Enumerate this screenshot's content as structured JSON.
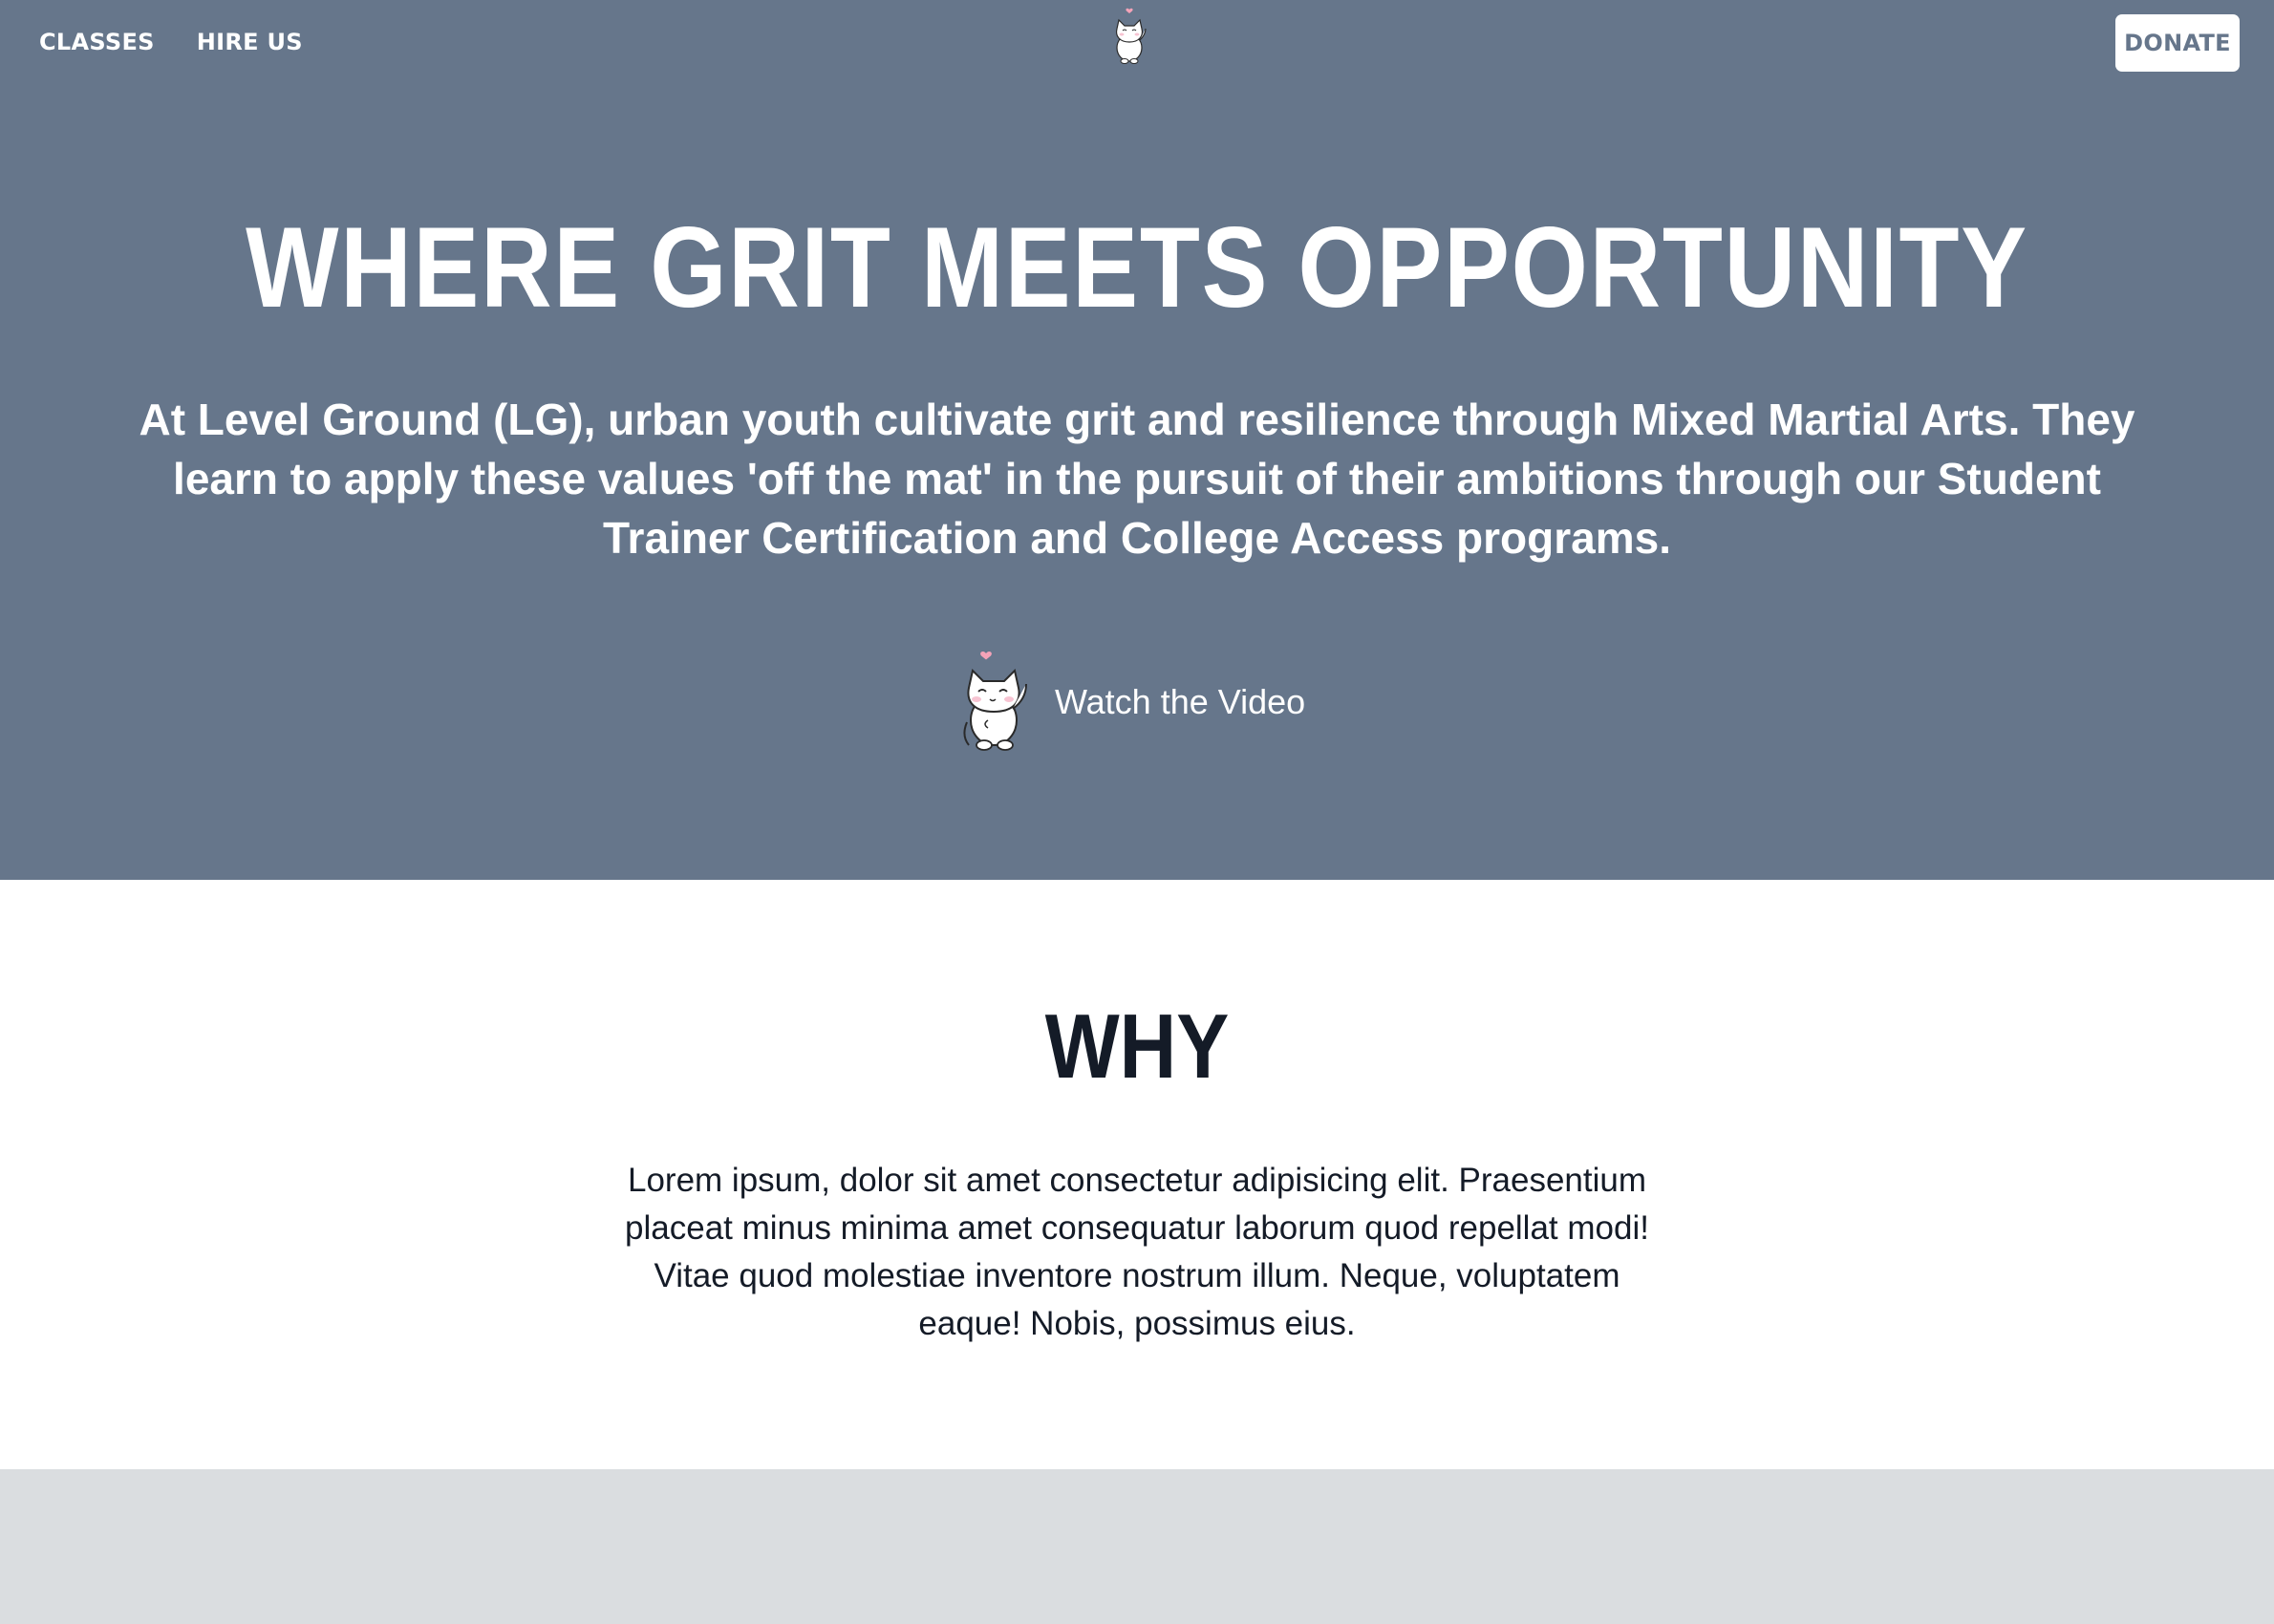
{
  "nav": {
    "links": [
      {
        "label": "CLASSES"
      },
      {
        "label": "HIRE US"
      }
    ],
    "donate_label": "DONATE",
    "logo_icon": "cat-mascot-icon"
  },
  "hero": {
    "title": "WHERE GRIT MEETS OPPORTUNITY",
    "subtitle": "At Level Ground (LG), urban youth cultivate grit and resilience through Mixed Martial Arts. They learn to apply these values 'off the mat' in the pursuit of their ambitions through our Student Trainer Certification and College Access programs.",
    "video_label": "Watch the Video",
    "video_icon": "cat-mascot-icon"
  },
  "why": {
    "title": "WHY",
    "body": "Lorem ipsum, dolor sit amet consectetur adipisicing elit. Praesentium placeat minus minima amet consequatur laborum quod repellat modi! Vitae quod molestiae inventore nostrum illum. Neque, voluptatem eaque! Nobis, possimus eius."
  },
  "colors": {
    "hero_bg": "#66768b",
    "why_bg": "#ffffff",
    "next_bg": "#dadde0",
    "text_dark": "#141b27",
    "heart": "#f4a3b8"
  }
}
